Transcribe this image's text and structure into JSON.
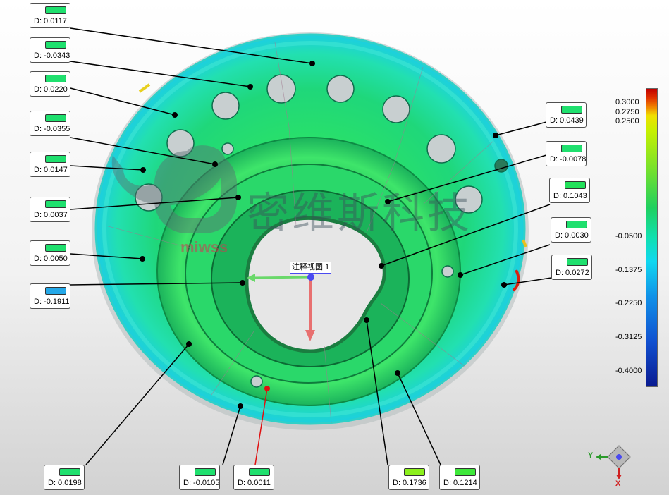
{
  "view_label": "注释视图 1",
  "watermark": {
    "brand_cn": "密维斯科技",
    "brand_en": "miwss"
  },
  "colors": {
    "green": "#1fe06e",
    "bright_green": "#8cf01c",
    "blue": "#24a8e8"
  },
  "callouts": [
    {
      "id": "c1",
      "text": "D: 0.0117",
      "color": "#1fe06e"
    },
    {
      "id": "c2",
      "text": "D: -0.0343",
      "color": "#1fe06e"
    },
    {
      "id": "c3",
      "text": "D: 0.0220",
      "color": "#1fe06e"
    },
    {
      "id": "c4",
      "text": "D: -0.0355",
      "color": "#1fe06e"
    },
    {
      "id": "c5",
      "text": "D: 0.0147",
      "color": "#1fe06e"
    },
    {
      "id": "c6",
      "text": "D: 0.0037",
      "color": "#1fe06e"
    },
    {
      "id": "c7",
      "text": "D: 0.0050",
      "color": "#1fe06e"
    },
    {
      "id": "c8",
      "text": "D: -0.1911",
      "color": "#24a8e8"
    },
    {
      "id": "c9",
      "text": "D: 0.0439",
      "color": "#1fe06e"
    },
    {
      "id": "c10",
      "text": "D: -0.0078",
      "color": "#1fe06e"
    },
    {
      "id": "c11",
      "text": "D: 0.1043",
      "color": "#22e05a"
    },
    {
      "id": "c12",
      "text": "D: 0.0030",
      "color": "#1fe06e"
    },
    {
      "id": "c13",
      "text": "D: 0.0272",
      "color": "#1fe06e"
    },
    {
      "id": "c14",
      "text": "D: 0.0198",
      "color": "#1fe06e"
    },
    {
      "id": "c15",
      "text": "D: -0.0105",
      "color": "#1fe06e"
    },
    {
      "id": "c16",
      "text": "D: 0.0011",
      "color": "#1fe06e"
    },
    {
      "id": "c17",
      "text": "D: 0.1736",
      "color": "#8cf01c"
    },
    {
      "id": "c18",
      "text": "D: 0.1214",
      "color": "#3ee83a"
    }
  ],
  "color_scale": {
    "ticks": [
      "0.3000",
      "0.2750",
      "0.2500",
      "-0.0500",
      "-0.1375",
      "-0.2250",
      "-0.3125",
      "-0.4000"
    ],
    "max": 0.3,
    "min": -0.4
  },
  "triad": {
    "y_label": "Y",
    "x_label": "X"
  }
}
